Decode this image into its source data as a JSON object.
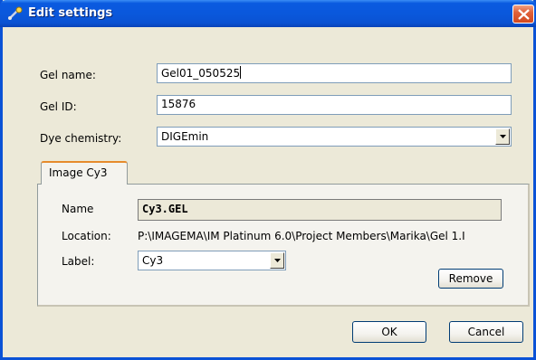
{
  "window": {
    "title": "Edit settings"
  },
  "form": {
    "gel_name_label": "Gel name:",
    "gel_name_value": "Gel01_050525",
    "gel_id_label": "Gel ID:",
    "gel_id_value": "15876",
    "dye_chemistry_label": "Dye chemistry:",
    "dye_chemistry_value": "DIGEmin"
  },
  "tabs": [
    {
      "label": "Image Cy3",
      "selected": true
    }
  ],
  "image_panel": {
    "name_label": "Name",
    "name_value": "Cy3.GEL",
    "location_label": "Location:",
    "location_value": "P:\\IMAGEMA\\IM Platinum 6.0\\Project Members\\Marika\\Gel 1.I",
    "label_label": "Label:",
    "label_value": "Cy3",
    "remove_button": "Remove"
  },
  "footer": {
    "ok_button": "OK",
    "cancel_button": "Cancel"
  },
  "colors": {
    "titlebar": "#0a5ae0",
    "close_button": "#e0613a",
    "dialog_face": "#ece9d8",
    "tab_highlight": "#e68b2c"
  },
  "icons": {
    "title_icon": "gel-settings-icon",
    "close": "close-icon",
    "dropdown": "chevron-down-icon"
  }
}
